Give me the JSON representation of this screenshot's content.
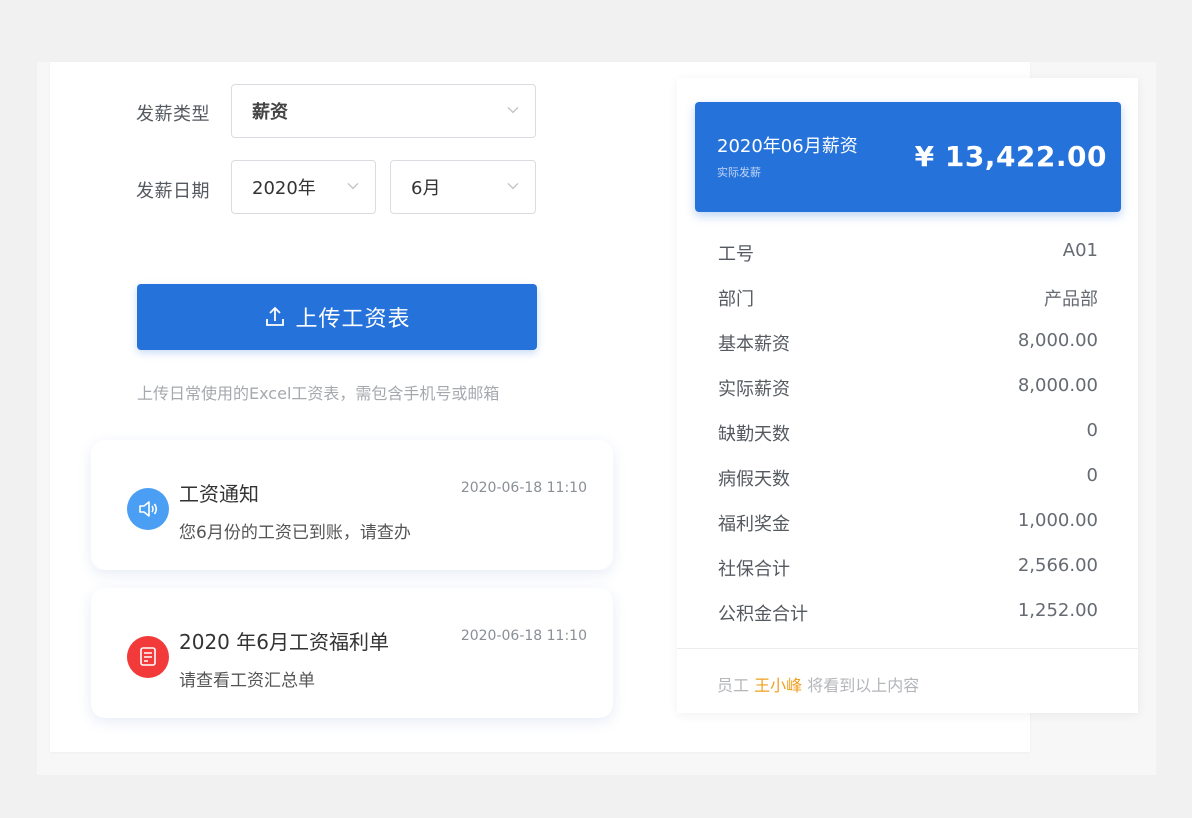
{
  "form": {
    "type_label": "发薪类型",
    "type_value": "薪资",
    "date_label": "发薪日期",
    "year_value": "2020年",
    "month_value": "6月"
  },
  "upload": {
    "button_label": "上传工资表",
    "hint": "上传日常使用的Excel工资表，需包含手机号或邮箱"
  },
  "notices": [
    {
      "title": "工资通知",
      "desc": "您6月份的工资已到账，请查办",
      "time": "2020-06-18 11:10",
      "icon": "speaker-icon",
      "color": "#4a9ff5"
    },
    {
      "title": "2020 年6月工资福利单",
      "desc": "请查看工资汇总单",
      "time": "2020-06-18 11:10",
      "icon": "document-icon",
      "color": "#f23a3a"
    }
  ],
  "payslip": {
    "period": "2020年06月薪资",
    "subtitle": "实际发薪",
    "amount": "¥ 13,422.00",
    "rows": [
      {
        "k": "工号",
        "v": "A01"
      },
      {
        "k": "部门",
        "v": "产品部"
      },
      {
        "k": "基本薪资",
        "v": "8,000.00"
      },
      {
        "k": "实际薪资",
        "v": "8,000.00"
      },
      {
        "k": "缺勤天数",
        "v": "0"
      },
      {
        "k": "病假天数",
        "v": "0"
      },
      {
        "k": "福利奖金",
        "v": "1,000.00"
      },
      {
        "k": "社保合计",
        "v": "2,566.00"
      },
      {
        "k": "公积金合计",
        "v": "1,252.00"
      }
    ],
    "footer_prefix": "员工",
    "footer_name": "王小峰",
    "footer_suffix": "将看到以上内容"
  },
  "colors": {
    "primary": "#2672db",
    "highlight": "#f0a020"
  }
}
